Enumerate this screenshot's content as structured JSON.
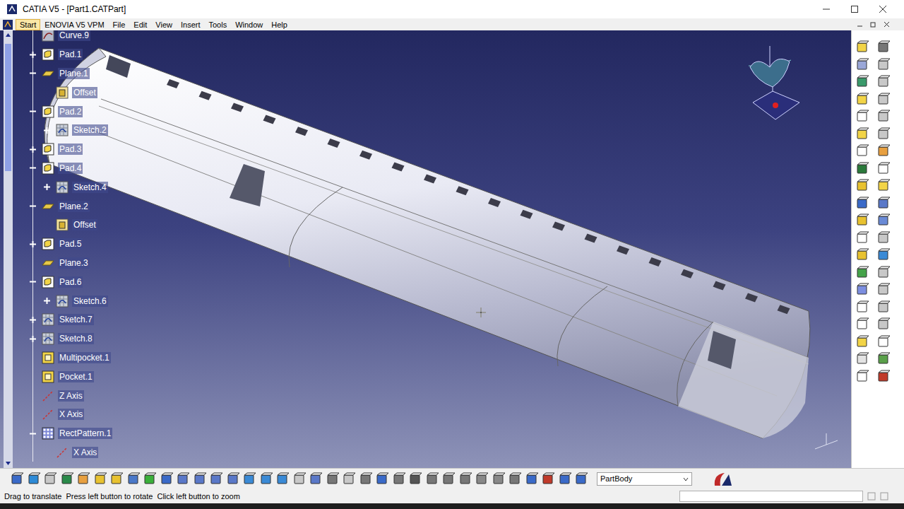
{
  "window": {
    "title": "CATIA V5 - [Part1.CATPart]"
  },
  "menu": [
    {
      "label": "Start",
      "selected": true
    },
    {
      "label": "ENOVIA V5 VPM",
      "selected": false
    },
    {
      "label": "File",
      "selected": false
    },
    {
      "label": "Edit",
      "selected": false
    },
    {
      "label": "View",
      "selected": false
    },
    {
      "label": "Insert",
      "selected": false
    },
    {
      "label": "Tools",
      "selected": false
    },
    {
      "label": "Window",
      "selected": false
    },
    {
      "label": "Help",
      "selected": false
    }
  ],
  "tree": [
    {
      "label": "Curve.9",
      "kind": "curve",
      "expandable": false,
      "expanded": false,
      "children": []
    },
    {
      "label": "Pad.1",
      "kind": "pad",
      "expandable": true,
      "expanded": false,
      "children": []
    },
    {
      "label": "Plane.1",
      "kind": "plane",
      "expandable": true,
      "expanded": true,
      "children": [
        {
          "label": "Offset",
          "kind": "offset",
          "expandable": false,
          "expanded": false,
          "children": []
        }
      ]
    },
    {
      "label": "Pad.2",
      "kind": "pad",
      "expandable": true,
      "expanded": true,
      "children": [
        {
          "label": "Sketch.2",
          "kind": "sketch",
          "expandable": true,
          "expanded": false,
          "children": []
        }
      ]
    },
    {
      "label": "Pad.3",
      "kind": "pad",
      "expandable": true,
      "expanded": false,
      "children": []
    },
    {
      "label": "Pad.4",
      "kind": "pad",
      "expandable": true,
      "expanded": true,
      "children": [
        {
          "label": "Sketch.4",
          "kind": "sketch",
          "expandable": true,
          "expanded": false,
          "children": []
        }
      ]
    },
    {
      "label": "Plane.2",
      "kind": "plane",
      "expandable": true,
      "expanded": true,
      "children": [
        {
          "label": "Offset",
          "kind": "offset",
          "expandable": false,
          "expanded": false,
          "children": []
        }
      ]
    },
    {
      "label": "Pad.5",
      "kind": "pad",
      "expandable": true,
      "expanded": false,
      "children": []
    },
    {
      "label": "Plane.3",
      "kind": "plane",
      "expandable": false,
      "expanded": false,
      "children": []
    },
    {
      "label": "Pad.6",
      "kind": "pad",
      "expandable": true,
      "expanded": true,
      "children": [
        {
          "label": "Sketch.6",
          "kind": "sketch",
          "expandable": true,
          "expanded": false,
          "children": []
        }
      ]
    },
    {
      "label": "Sketch.7",
      "kind": "sketch",
      "expandable": true,
      "expanded": false,
      "children": []
    },
    {
      "label": "Sketch.8",
      "kind": "sketch",
      "expandable": true,
      "expanded": false,
      "children": []
    },
    {
      "label": "Multipocket.1",
      "kind": "pocket",
      "expandable": false,
      "expanded": false,
      "children": []
    },
    {
      "label": "Pocket.1",
      "kind": "pocket",
      "expandable": false,
      "expanded": false,
      "children": []
    },
    {
      "label": "Z Axis",
      "kind": "axis",
      "expandable": false,
      "expanded": false,
      "children": []
    },
    {
      "label": "X Axis",
      "kind": "axis",
      "expandable": false,
      "expanded": false,
      "children": []
    },
    {
      "label": "RectPattern.1",
      "kind": "pattern",
      "expandable": true,
      "expanded": true,
      "children": [
        {
          "label": "X Axis",
          "kind": "axis",
          "expandable": false,
          "expanded": false,
          "children": []
        }
      ]
    }
  ],
  "toolbar": {
    "body_select": "PartBody"
  },
  "status_bar": {
    "message": "Drag to translate  Press left button to rotate  Click left button to zoom"
  }
}
